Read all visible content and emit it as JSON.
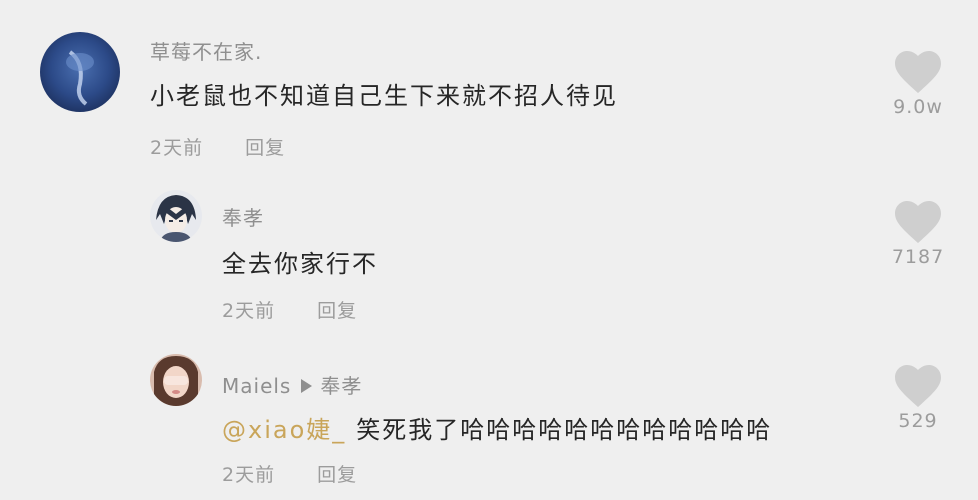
{
  "comments": [
    {
      "username": "草莓不在家.",
      "text": "小老鼠也不知道自己生下来就不招人待见",
      "time": "2天前",
      "reply_label": "回复",
      "likes": "9.0w",
      "avatar_icon": "blue-abstract-avatar"
    },
    {
      "username": "奉孝",
      "text": "全去你家行不",
      "time": "2天前",
      "reply_label": "回复",
      "likes": "7187",
      "avatar_icon": "anime-boy-avatar"
    },
    {
      "username": "Maiels",
      "reply_to": "奉孝",
      "mention": "@xiao婕_",
      "text": "笑死我了哈哈哈哈哈哈哈哈哈哈哈哈",
      "time": "2天前",
      "reply_label": "回复",
      "likes": "529",
      "avatar_icon": "girl-photo-avatar"
    }
  ],
  "colors": {
    "background": "#efefef",
    "mention": "#c9a55a",
    "heart": "#cfcfcf",
    "meta": "#9c9c9c"
  }
}
